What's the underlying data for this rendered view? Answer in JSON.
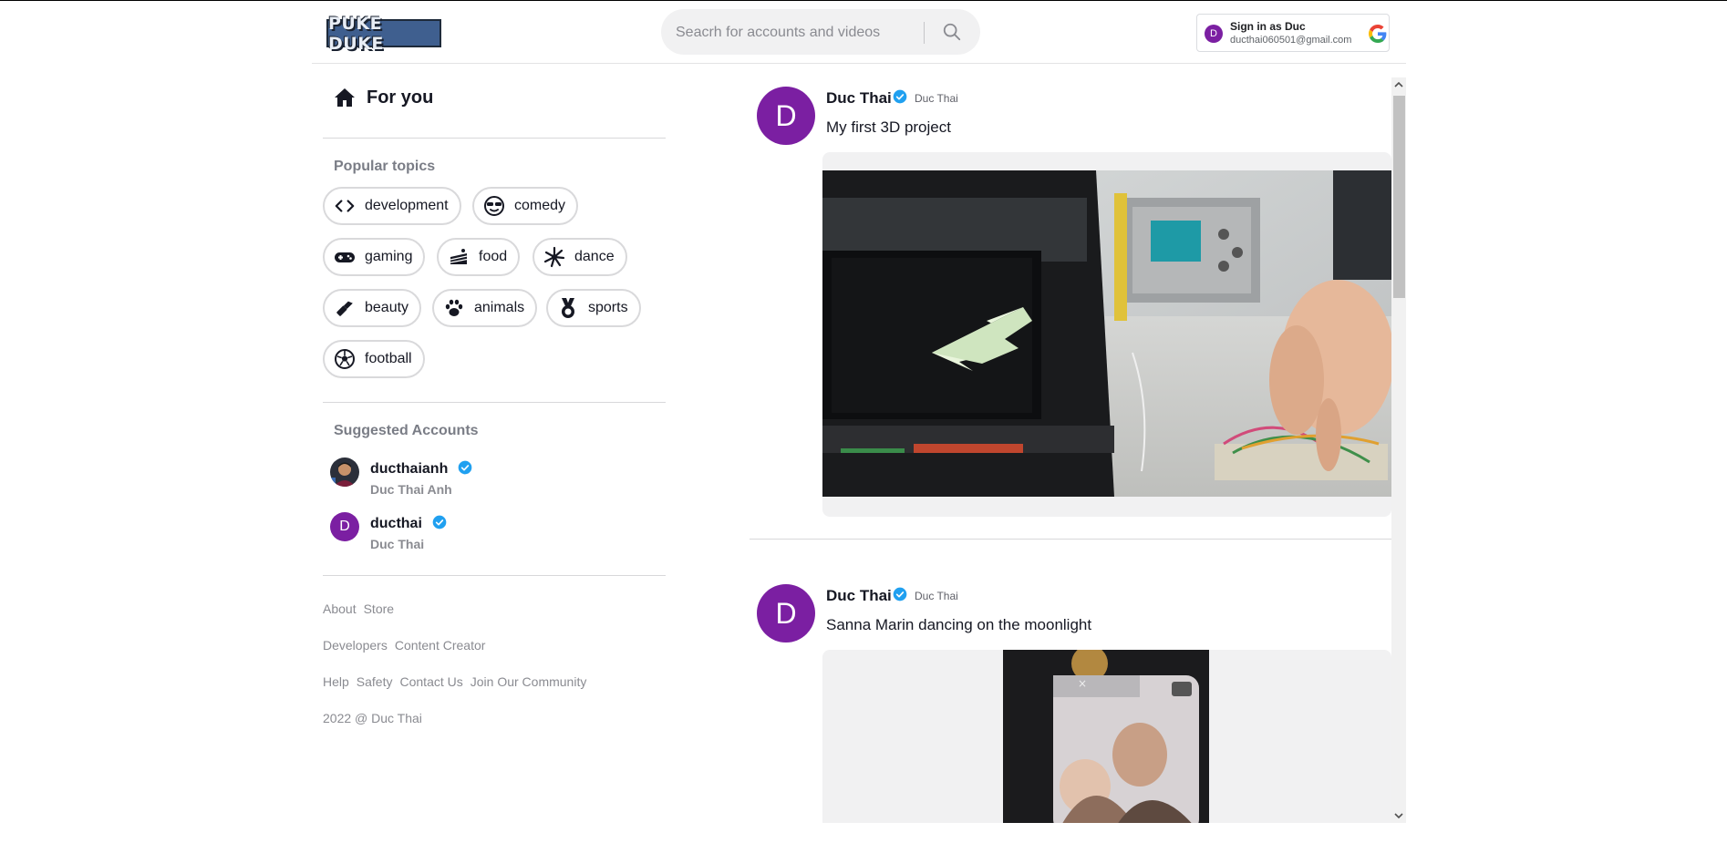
{
  "header": {
    "logo_text": "PUKE DUKE",
    "search_placeholder": "Seacrh for accounts and videos",
    "signin": {
      "avatar_letter": "D",
      "title": "Sign in as Duc",
      "email": "ducthai060501@gmail.com"
    }
  },
  "sidebar": {
    "for_you": "For you",
    "popular_topics_title": "Popular topics",
    "topics": [
      {
        "label": "development",
        "icon": "code-icon"
      },
      {
        "label": "comedy",
        "icon": "sunglasses-face-icon"
      },
      {
        "label": "gaming",
        "icon": "gamepad-icon"
      },
      {
        "label": "food",
        "icon": "cake-icon"
      },
      {
        "label": "dance",
        "icon": "dance-icon"
      },
      {
        "label": "beauty",
        "icon": "lipstick-icon"
      },
      {
        "label": "animals",
        "icon": "paw-icon"
      },
      {
        "label": "sports",
        "icon": "medal-icon"
      },
      {
        "label": "football",
        "icon": "soccer-ball-icon"
      }
    ],
    "suggested_title": "Suggested Accounts",
    "accounts": [
      {
        "username": "ducthaianh",
        "fullname": "Duc Thai Anh"
      },
      {
        "username": "ducthai",
        "fullname": "Duc Thai",
        "avatar_letter": "D"
      }
    ],
    "footer": {
      "row1": [
        "About",
        "Store"
      ],
      "row2": [
        "Developers",
        "Content Creator"
      ],
      "row3": [
        "Help",
        "Safety",
        "Contact Us",
        "Join Our Community"
      ],
      "copyright": "2022 @ Duc Thai"
    }
  },
  "feed": {
    "posts": [
      {
        "avatar_letter": "D",
        "name": "Duc Thai",
        "nickname": "Duc Thai",
        "caption": "My first 3D project"
      },
      {
        "avatar_letter": "D",
        "name": "Duc Thai",
        "nickname": "Duc Thai",
        "caption": "Sanna Marin dancing on the moonlight"
      }
    ]
  },
  "colors": {
    "avatar_purple": "#7b1fa2",
    "verified_blue": "#20a0f0",
    "chip_border": "#d9d9db",
    "muted_text": "#8a8b91"
  }
}
